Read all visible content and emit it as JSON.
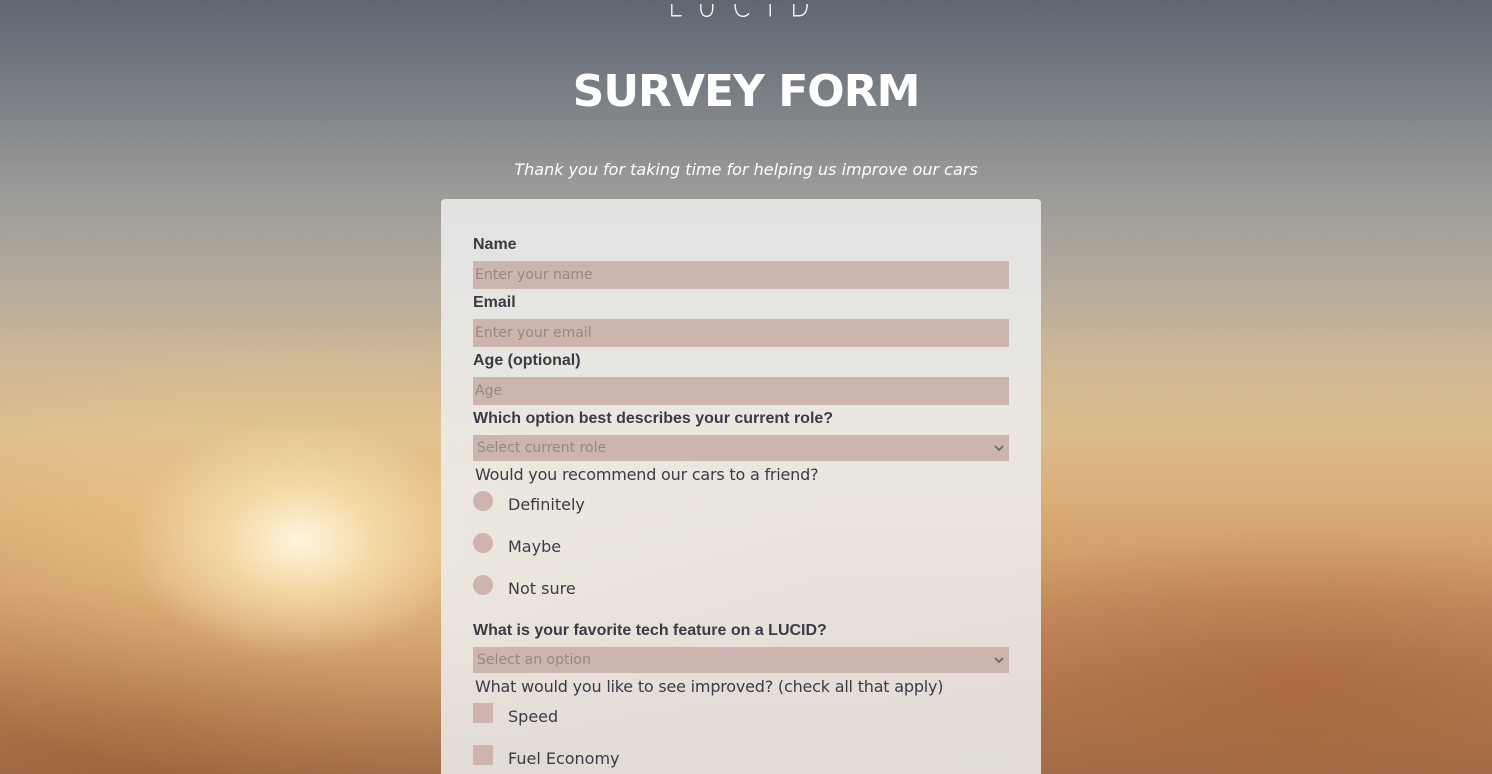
{
  "brand": {
    "logo_text": "LUCID"
  },
  "header": {
    "title": "SURVEY FORM",
    "description": "Thank you for taking time for helping us improve our cars"
  },
  "form": {
    "name": {
      "label": "Name",
      "placeholder": "Enter your name",
      "value": ""
    },
    "email": {
      "label": "Email",
      "placeholder": "Enter your email",
      "value": ""
    },
    "age": {
      "label": "Age (optional)",
      "placeholder": "Age",
      "value": ""
    },
    "role": {
      "label": "Which option best describes your current role?",
      "selected": "Select current role",
      "icon": "chevron-down-icon"
    },
    "recommend": {
      "label": "Would you recommend our cars to a friend?",
      "options": [
        "Definitely",
        "Maybe",
        "Not sure"
      ]
    },
    "feature": {
      "label": "What is your favorite tech feature on a LUCID?",
      "selected": "Select an option",
      "icon": "chevron-down-icon"
    },
    "improve": {
      "label": "What would you like to see improved? (check all that apply)",
      "options": [
        "Speed",
        "Fuel Economy"
      ]
    }
  },
  "colors": {
    "field_background": "#cbb5ae",
    "card_background": "#eceeee",
    "text": "#3b3b45",
    "heading": "#ffffff"
  }
}
